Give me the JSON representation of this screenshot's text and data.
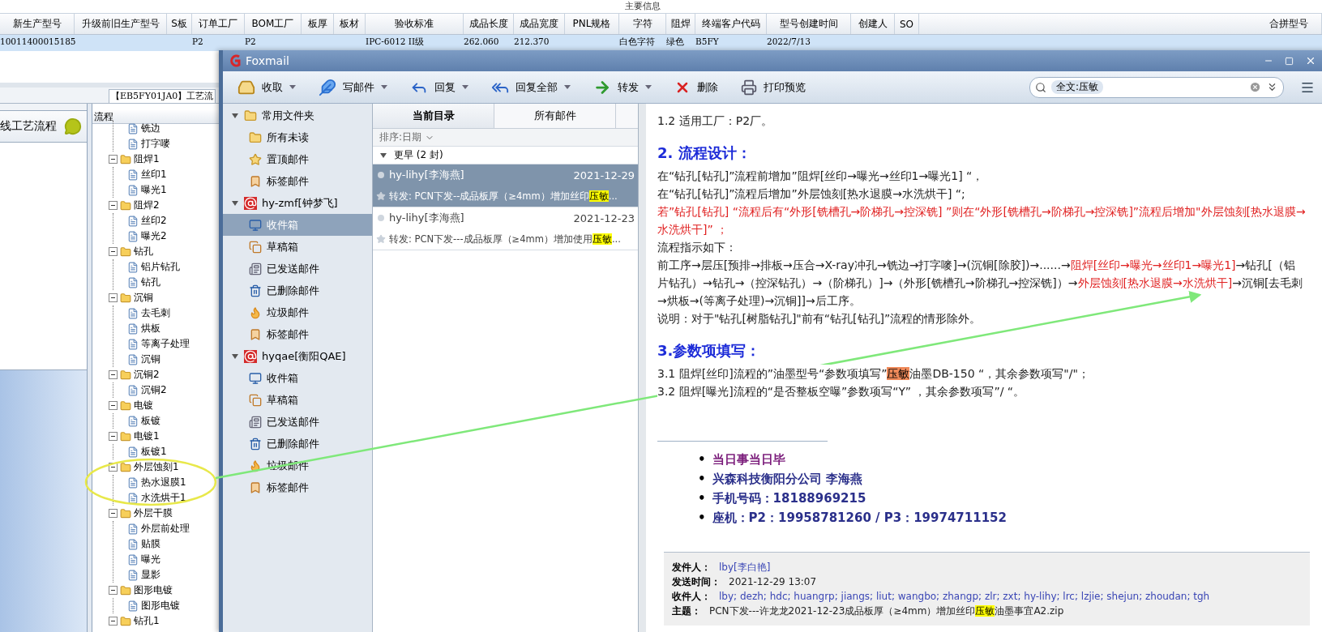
{
  "table": {
    "group_header": "主要信息",
    "columns": [
      "新生产型号",
      "升级前旧生产型号",
      "S板",
      "订单工厂",
      "BOM工厂",
      "板厚",
      "板材",
      "验收标准",
      "成品长度",
      "成品宽度",
      "PNL规格",
      "字符",
      "阻焊",
      "终端客户代码",
      "型号创建时间",
      "创建人",
      "SO"
    ],
    "rows": [
      {
        "selected": true,
        "cells": [
          "10011400015185",
          null,
          null,
          "P2",
          "P2",
          null,
          null,
          "IPC-6012 II级",
          "262.060",
          "212.370",
          null,
          "白色字符",
          "绿色",
          "B5FY",
          "2022/7/13",
          null,
          null
        ]
      }
    ]
  },
  "merge_panel": {
    "header": "合拼型号"
  },
  "process_tab": {
    "label": "【EB5FY01JA0】工艺流"
  },
  "left_panel": {
    "header": "线工艺流程"
  },
  "process_tree": {
    "header": "流程",
    "leaves": [
      {
        "label": "铣边"
      },
      {
        "label": "打字嘜"
      }
    ],
    "groups": [
      {
        "label": "阻焊1",
        "expanded": true,
        "children": [
          {
            "label": "丝印1"
          },
          {
            "label": "曝光1"
          }
        ]
      },
      {
        "label": "阻焊2",
        "expanded": true,
        "children": [
          {
            "label": "丝印2"
          },
          {
            "label": "曝光2"
          }
        ]
      },
      {
        "label": "钻孔",
        "expanded": true,
        "children": [
          {
            "label": "铝片钻孔"
          },
          {
            "label": "钻孔"
          }
        ]
      },
      {
        "label": "沉铜",
        "expanded": true,
        "children": [
          {
            "label": "去毛刺"
          },
          {
            "label": "烘板"
          },
          {
            "label": "等离子处理"
          },
          {
            "label": "沉铜"
          }
        ]
      },
      {
        "label": "沉铜2",
        "expanded": true,
        "children": [
          {
            "label": "沉铜2"
          }
        ]
      },
      {
        "label": "电镀",
        "expanded": true,
        "children": [
          {
            "label": "板镀"
          }
        ]
      },
      {
        "label": "电镀1",
        "expanded": true,
        "children": [
          {
            "label": "板镀1"
          }
        ]
      },
      {
        "label": "外层蚀刻1",
        "expanded": true,
        "children": [
          {
            "label": "热水退膜1"
          },
          {
            "label": "水洗烘干1"
          }
        ]
      },
      {
        "label": "外层干膜",
        "expanded": true,
        "children": [
          {
            "label": "外层前处理"
          },
          {
            "label": "贴膜"
          },
          {
            "label": "曝光"
          },
          {
            "label": "显影"
          }
        ]
      },
      {
        "label": "图形电镀",
        "expanded": true,
        "children": [
          {
            "label": "图形电镀"
          }
        ]
      },
      {
        "label": "钻孔1",
        "expanded": true
      }
    ]
  },
  "foxmail": {
    "title": "Foxmail",
    "toolbar": [
      {
        "label": "收取",
        "kind": "receive",
        "menu": true
      },
      {
        "label": "写邮件",
        "kind": "compose",
        "menu": true
      },
      {
        "label": "回复",
        "kind": "reply",
        "menu": true
      },
      {
        "label": "回复全部",
        "kind": "reply_all",
        "menu": true
      },
      {
        "label": "转发",
        "kind": "forward",
        "menu": true
      },
      {
        "label": "删除",
        "kind": "delete",
        "menu": false
      },
      {
        "label": "打印预览",
        "kind": "print",
        "menu": false
      }
    ],
    "search": {
      "chip": "全文:压敏"
    },
    "folder_groups": [
      {
        "label": "常用文件夹",
        "kind": "favorites",
        "expanded": true,
        "items": [
          {
            "label": "所有未读",
            "kind": "unread",
            "selected": false
          },
          {
            "label": "置顶邮件",
            "kind": "pinned",
            "selected": false
          },
          {
            "label": "标签邮件",
            "kind": "tag",
            "selected": false
          }
        ]
      },
      {
        "label": "hy-zmf[钟梦飞]",
        "kind": "account",
        "expanded": true,
        "items": [
          {
            "label": "收件箱",
            "kind": "inbox",
            "selected": true
          },
          {
            "label": "草稿箱",
            "kind": "drafts",
            "selected": false
          },
          {
            "label": "已发送邮件",
            "kind": "sent",
            "selected": false
          },
          {
            "label": "已删除邮件",
            "kind": "deleted",
            "selected": false
          },
          {
            "label": "垃圾邮件",
            "kind": "junk",
            "selected": false
          },
          {
            "label": "标签邮件",
            "kind": "tag",
            "selected": false
          }
        ]
      },
      {
        "label": "hyqae[衡阳QAE]",
        "kind": "account",
        "expanded": true,
        "items": [
          {
            "label": "收件箱",
            "kind": "inbox",
            "selected": false
          },
          {
            "label": "草稿箱",
            "kind": "drafts",
            "selected": false
          },
          {
            "label": "已发送邮件",
            "kind": "sent",
            "selected": false
          },
          {
            "label": "已删除邮件",
            "kind": "deleted",
            "selected": false
          },
          {
            "label": "垃圾邮件",
            "kind": "junk",
            "selected": false
          },
          {
            "label": "标签邮件",
            "kind": "tag",
            "selected": false
          }
        ]
      }
    ],
    "list_tabs": [
      {
        "label": "当前目录",
        "selected": true
      },
      {
        "label": "所有邮件",
        "selected": false
      }
    ],
    "sort": "排序:日期",
    "group": {
      "label": "更早 (2 封)",
      "expanded": true
    },
    "messages": [
      {
        "sender": "hy-lihy[李海燕]",
        "date": "2021-12-29",
        "selected": true,
        "subject": [
          {
            "text": "转发: PCN下发--成品板厚（≥4mm）增加丝印",
            "kind": "plain"
          },
          {
            "text": "压敏",
            "kind": "match"
          },
          {
            "text": "...",
            "kind": "plain"
          }
        ]
      },
      {
        "sender": "hy-lihy[李海燕]",
        "date": "2021-12-23",
        "selected": false,
        "subject": [
          {
            "text": "转发: PCN下发---成品板厚（≥4mm）增加使用",
            "kind": "plain"
          },
          {
            "text": "压敏",
            "kind": "match"
          },
          {
            "text": "...",
            "kind": "plain"
          }
        ]
      }
    ],
    "body": [
      {
        "kind": "paragraph",
        "runs": [
          {
            "text": "1.2  适用工厂：P2厂。",
            "kind": "plain"
          }
        ]
      },
      {
        "kind": "heading",
        "runs": [
          {
            "text": "2. 流程设计：",
            "kind": "plain"
          }
        ]
      },
      {
        "kind": "paragraph",
        "runs": [
          {
            "text": "在“钻孔[钻孔]”流程前增加”阻焊[丝印→曝光→丝印1→曝光1] “，",
            "kind": "plain"
          }
        ]
      },
      {
        "kind": "paragraph",
        "runs": [
          {
            "text": "在“钻孔[钻孔]”流程后增加”外层蚀刻[热水退膜→水洗烘干] “;",
            "kind": "plain"
          }
        ]
      },
      {
        "kind": "paragraph",
        "runs": [
          {
            "text": "若”钻孔[钻孔] “流程后有“外形[铣槽孔→阶梯孔→控深铣] ”则在“外形[铣槽孔→阶梯孔→控深铣]”流程后增加\"外层蚀刻[热水退膜→水洗烘干]” ；",
            "kind": "emphasis"
          }
        ]
      },
      {
        "kind": "paragraph",
        "runs": [
          {
            "text": "流程指示如下：",
            "kind": "plain"
          }
        ]
      },
      {
        "kind": "paragraph",
        "runs": [
          {
            "text": "前工序→层压[预排→排板→压合→X-ray冲孔→铣边→打字嘜]→(沉铜[除胶])→......→",
            "kind": "plain"
          },
          {
            "text": "阻焊[丝印→曝光→丝印1→曝光1]",
            "kind": "emphasis"
          },
          {
            "text": "→钻孔[（铝片钻孔）→钻孔→（控深钻孔）→（阶梯孔）]→（外形[铣槽孔→阶梯孔→控深铣]）→",
            "kind": "plain"
          },
          {
            "text": "外层蚀刻[热水退膜→水洗烘干]",
            "kind": "emphasis"
          },
          {
            "text": "→沉铜[去毛刺→烘板→(等离子处理)→沉铜]]→后工序。",
            "kind": "plain"
          }
        ]
      },
      {
        "kind": "paragraph",
        "runs": [
          {
            "text": "说明：对于\"钻孔[树脂钻孔]\"前有“钻孔[钻孔]”流程的情形除外。",
            "kind": "plain"
          }
        ]
      },
      {
        "kind": "heading",
        "runs": [
          {
            "text": "3.参数项填写：",
            "kind": "plain"
          }
        ]
      },
      {
        "kind": "paragraph",
        "runs": [
          {
            "text": "3.1 阻焊[丝印]流程的”油墨型号“参数项填写”",
            "kind": "plain"
          },
          {
            "text": "压敏",
            "kind": "match"
          },
          {
            "text": "油墨DB-150 “，其余参数项写\"/\"；",
            "kind": "plain"
          }
        ]
      },
      {
        "kind": "paragraph",
        "runs": [
          {
            "text": "3.2 阻焊[曝光]流程的“是否整板空曝”参数项写“Y” ，其余参数项写”/ “。",
            "kind": "plain"
          }
        ]
      }
    ],
    "signature": [
      {
        "bullet": "•",
        "text": "当日事当日毕",
        "kind": "motto"
      },
      {
        "bullet": "•",
        "text": "兴森科技衡阳分公司   李海燕",
        "kind": "contact"
      },
      {
        "bullet": "•",
        "text": "手机号码：18188969215",
        "kind": "contact"
      },
      {
        "bullet": "•",
        "text": "座机：P2：19958781260 / P3：19974711152",
        "kind": "contact"
      }
    ],
    "meta": [
      {
        "label": "发件人：",
        "kind": "link",
        "runs": [
          {
            "text": "lby[李白艳]",
            "kind": "plain"
          }
        ]
      },
      {
        "label": "发送时间：",
        "kind": "text",
        "runs": [
          {
            "text": "2021-12-29 13:07",
            "kind": "plain"
          }
        ]
      },
      {
        "label": "收件人：",
        "kind": "link",
        "runs": [
          {
            "text": "lby; dezh; hdc; huangrp; jiangs; liut; wangbo; zhangp; zlr; zxt; hy-lihy; lrc; lzjie; shejun; zhoudan; tgh",
            "kind": "plain"
          }
        ]
      },
      {
        "label": "主题：",
        "kind": "text",
        "runs": [
          {
            "text": "PCN下发---许龙龙2021-12-23成品板厚（≥4mm）增加丝印",
            "kind": "plain"
          },
          {
            "text": "压敏",
            "kind": "match"
          },
          {
            "text": "油墨事宜A2.zip",
            "kind": "plain"
          }
        ]
      }
    ]
  }
}
